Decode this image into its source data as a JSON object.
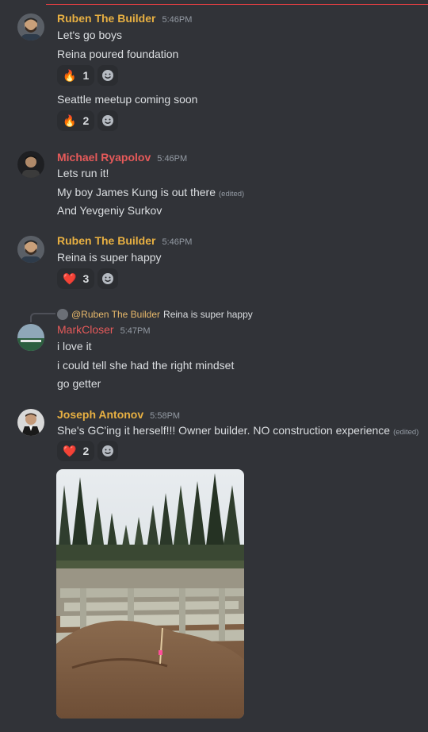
{
  "colors": {
    "ruben": "#e8b042",
    "michael": "#e65a5a",
    "mark": "#e65a5a",
    "joseph": "#e8b042"
  },
  "messages": [
    {
      "author": "Ruben The Builder",
      "time": "5:46PM",
      "lines": [
        "Let's go boys",
        "Reina poured foundation"
      ],
      "reaction": {
        "icon": "fire-icon",
        "emoji": "🔥",
        "count": "1"
      },
      "line3": "Seattle meetup coming soon",
      "reaction2": {
        "icon": "fire-icon",
        "emoji": "🔥",
        "count": "2"
      }
    },
    {
      "author": "Michael Ryapolov",
      "time": "5:46PM",
      "lines": [
        "Lets run it!",
        "My boy James Kung is out there",
        "And Yevgeniy Surkov"
      ],
      "edited": "(edited)"
    },
    {
      "author": "Ruben The Builder",
      "time": "5:46PM",
      "lines": [
        "Reina is super happy"
      ],
      "reaction": {
        "icon": "heart-icon",
        "emoji": "❤️",
        "count": "3"
      }
    },
    {
      "reply_to": "@Ruben The Builder",
      "reply_text": "Reina is super happy",
      "author": "MarkCloser",
      "time": "5:47PM",
      "lines": [
        "i love it",
        "i could tell she had the right mindset",
        "go getter"
      ]
    },
    {
      "author": "Joseph Antonov",
      "time": "5:58PM",
      "lines": [
        "She's GC'ing it herself!!! Owner builder.  NO construction experience"
      ],
      "edited": "(edited)",
      "reaction": {
        "icon": "heart-icon",
        "emoji": "❤️",
        "count": "2"
      },
      "attachment": "construction-foundation-photo"
    }
  ]
}
